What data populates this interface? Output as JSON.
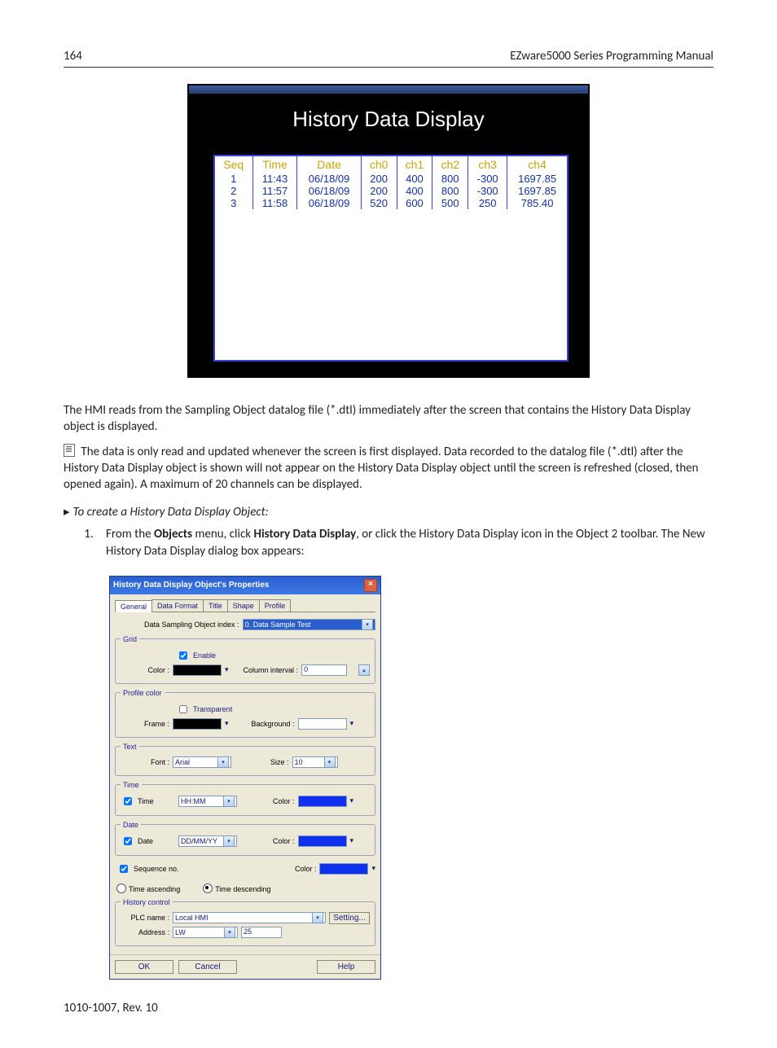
{
  "page_number": "164",
  "manual_title": "EZware5000 Series Programming Manual",
  "hmi": {
    "title": "History Data Display",
    "columns": [
      "Seq",
      "Time",
      "Date",
      "ch0",
      "ch1",
      "ch2",
      "ch3",
      "ch4"
    ],
    "rows": [
      [
        "1",
        "11:43",
        "06/18/09",
        "200",
        "400",
        "800",
        "-300",
        "1697.85"
      ],
      [
        "2",
        "11:57",
        "06/18/09",
        "200",
        "400",
        "800",
        "-300",
        "1697.85"
      ],
      [
        "3",
        "11:58",
        "06/18/09",
        "520",
        "600",
        "500",
        "250",
        "785.40"
      ]
    ]
  },
  "para1": "The HMI reads from the Sampling Object datalog file (*.dtl) immediately after the screen that contains the History Data Display object is displayed.",
  "para2": "The data is only read and updated whenever the screen is first displayed. Data recorded to the datalog file (*.dtl) after the History Data Display object is shown will not appear on the History Data Display object until the screen is refreshed (closed, then opened again). A maximum of 20 channels can be displayed.",
  "proc_heading": "To create a History Data Display Object:",
  "step1_pre": "From the ",
  "step1_b1": "Objects",
  "step1_mid": " menu, click ",
  "step1_b2": "History Data Display",
  "step1_post": ", or click the History Data Display icon in the Object 2 toolbar. The New History Data Display dialog box appears:",
  "dialog": {
    "title": "History Data Display Object's Properties",
    "tabs": [
      "General",
      "Data Format",
      "Title",
      "Shape",
      "Profile"
    ],
    "dsoi_label": "Data Sampling Object index :",
    "dsoi_value": "0. Data Sample Test",
    "grid": {
      "legend": "Grid",
      "enable": "Enable",
      "color_lbl": "Color :",
      "col_int_lbl": "Column interval :",
      "col_int_val": "0"
    },
    "profile": {
      "legend": "Profile color",
      "transparent": "Transparent",
      "frame_lbl": "Frame :",
      "bg_lbl": "Background :"
    },
    "text": {
      "legend": "Text",
      "font_lbl": "Font :",
      "font_val": "Arial",
      "size_lbl": "Size :",
      "size_val": "10"
    },
    "time": {
      "legend": "Time",
      "ck": "Time",
      "fmt": "HH:MM",
      "color_lbl": "Color :"
    },
    "date": {
      "legend": "Date",
      "ck": "Date",
      "fmt": "DD/MM/YY",
      "color_lbl": "Color :"
    },
    "seq": {
      "ck": "Sequence no.",
      "color_lbl": "Color :"
    },
    "order": {
      "asc": "Time ascending",
      "desc": "Time descending"
    },
    "hist": {
      "legend": "History control",
      "plc_lbl": "PLC name :",
      "plc_val": "Local HMI",
      "setting": "Setting...",
      "addr_lbl": "Address :",
      "addr_type": "LW",
      "addr_val": "25"
    },
    "buttons": {
      "ok": "OK",
      "cancel": "Cancel",
      "help": "Help"
    }
  },
  "doc_footer": "1010-1007, Rev. 10"
}
